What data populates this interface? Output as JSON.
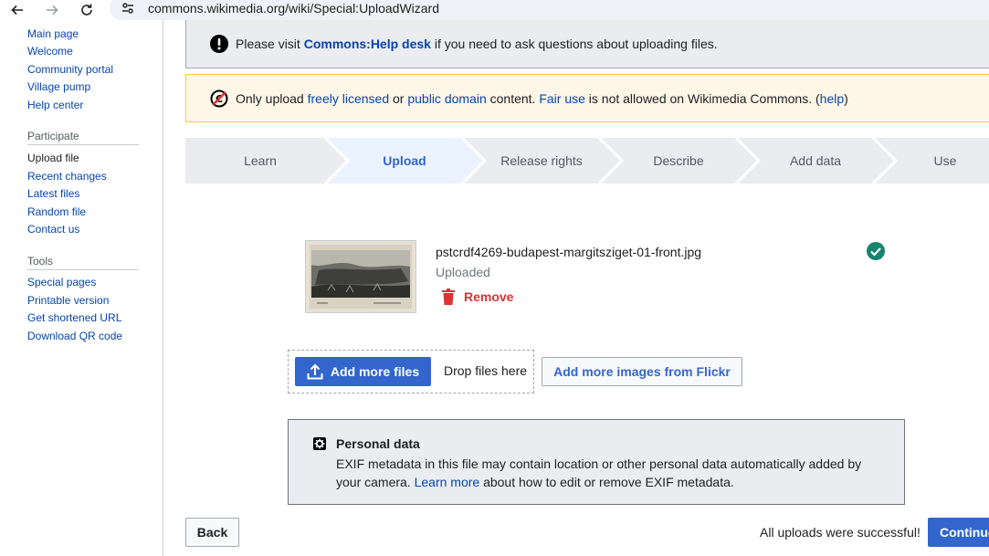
{
  "browser": {
    "url": "commons.wikimedia.org/wiki/Special:UploadWizard"
  },
  "sidebar": {
    "nav": [
      "Main page",
      "Welcome",
      "Community portal",
      "Village pump",
      "Help center"
    ],
    "participate_heading": "Participate",
    "participate": [
      "Upload file",
      "Recent changes",
      "Latest files",
      "Random file",
      "Contact us"
    ],
    "tools_heading": "Tools",
    "tools": [
      "Special pages",
      "Printable version",
      "Get shortened URL",
      "Download QR code"
    ]
  },
  "help_notice": {
    "prefix": "Please visit ",
    "link": "Commons:Help desk",
    "suffix": " if you need to ask questions about uploading files."
  },
  "license_notice": {
    "t1": "Only upload ",
    "l1": "freely licensed",
    "t2": " or ",
    "l2": "public domain",
    "t3": " content. ",
    "l3": "Fair use",
    "t4": " is not allowed on Wikimedia Commons. (",
    "l4": "help",
    "t5": ")"
  },
  "steps": [
    "Learn",
    "Upload",
    "Release rights",
    "Describe",
    "Add data",
    "Use"
  ],
  "active_step": "Upload",
  "file": {
    "name": "pstcrdf4269-budapest-margitsziget-01-front.jpg",
    "status": "Uploaded",
    "remove_label": "Remove"
  },
  "add_files": {
    "button": "Add more files",
    "drop_text": "Drop files here",
    "flickr_button": "Add more images from Flickr"
  },
  "personal_data": {
    "title": "Personal data",
    "text1": "EXIF metadata in this file may contain location or other personal data automatically added by your camera. ",
    "link": "Learn more",
    "text2": " about how to edit or remove EXIF metadata."
  },
  "footer": {
    "back": "Back",
    "success": "All uploads were successful!",
    "continue": "Continue"
  },
  "colors": {
    "accent": "#3366cc",
    "success": "#14866d",
    "destructive": "#dd3333",
    "active_step_bg": "#eaf3ff",
    "step_bg": "#eaecf0"
  }
}
